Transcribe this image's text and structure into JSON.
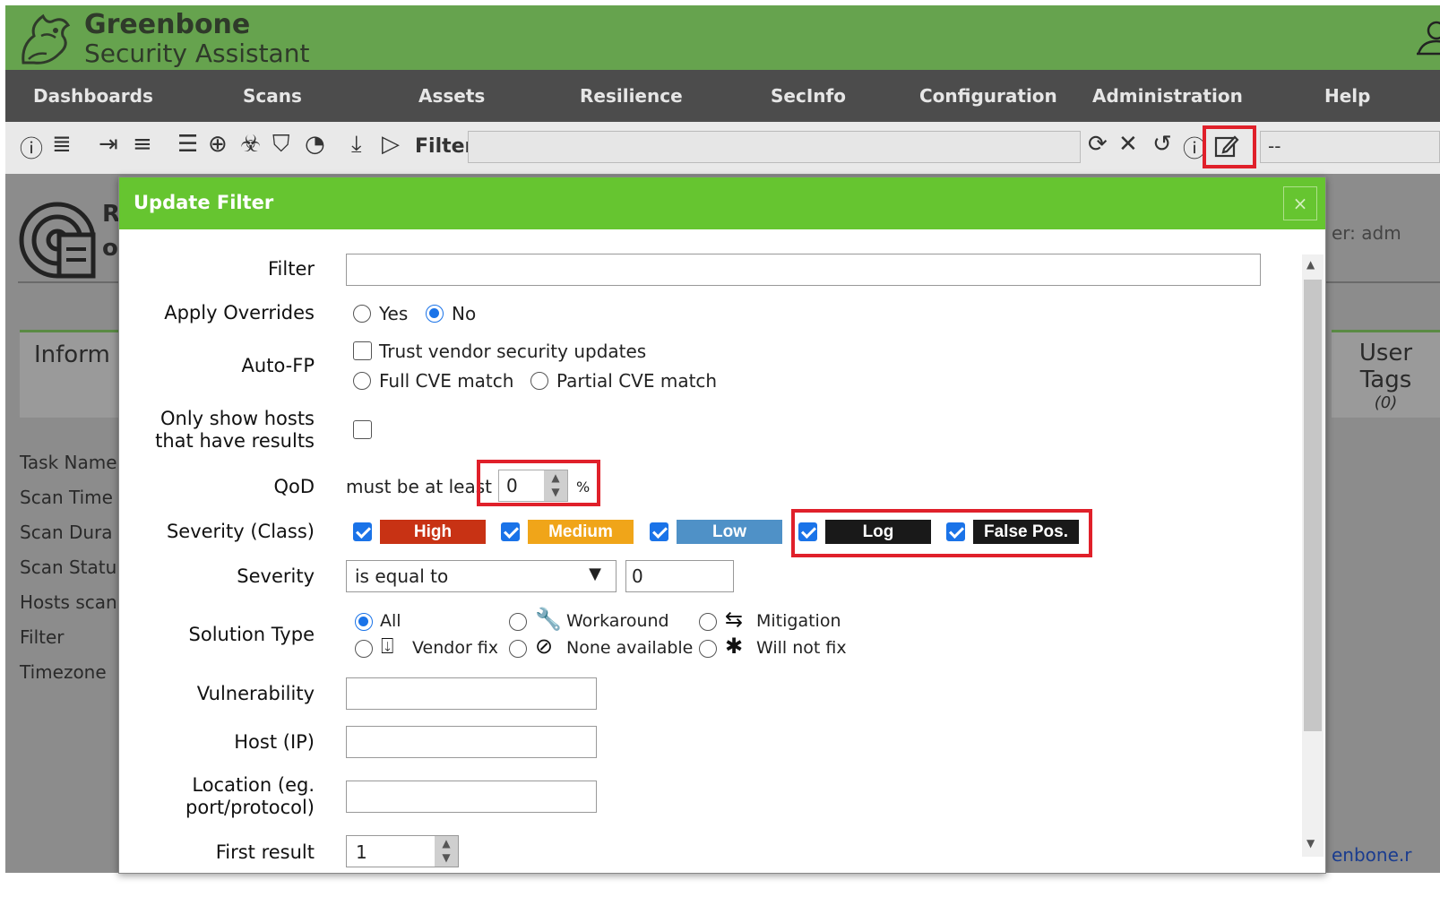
{
  "app": {
    "brand_line1": "Greenbone",
    "brand_line2": "Security Assistant"
  },
  "nav": {
    "items": [
      "Dashboards",
      "Scans",
      "Assets",
      "Resilience",
      "SecInfo",
      "Configuration",
      "Administration",
      "Help"
    ]
  },
  "toolbar": {
    "filter_label": "Filter",
    "filter_value": "",
    "saved_filter_selected": "--"
  },
  "page": {
    "title_fragment_1": "R",
    "title_fragment_2": "o",
    "owner_fragment": "er: adm",
    "info_tab_fragment": "Inform",
    "right_tab_line1": "User",
    "right_tab_line2": "Tags",
    "right_tab_count": "(0)",
    "details": [
      "Task Name",
      "Scan Time",
      "Scan Dura",
      "Scan Statu",
      "Hosts scan",
      "Filter",
      "Timezone"
    ],
    "footer_fragment": "enbone.r"
  },
  "modal": {
    "title": "Update Filter",
    "close_label": "×",
    "fields": {
      "filter": {
        "label": "Filter",
        "value": ""
      },
      "apply_overrides": {
        "label": "Apply Overrides",
        "yes": "Yes",
        "no": "No",
        "selected": "No"
      },
      "auto_fp": {
        "label": "Auto-FP",
        "trust_vendor": "Trust vendor security updates",
        "full_cve": "Full CVE match",
        "partial_cve": "Partial CVE match"
      },
      "only_hosts": {
        "label_line1": "Only show hosts",
        "label_line2": "that have results",
        "checked": false
      },
      "qod": {
        "label": "QoD",
        "prefix": "must be at least",
        "value": "0",
        "suffix": "%"
      },
      "severity_class": {
        "label": "Severity (Class)",
        "classes": [
          {
            "name": "High",
            "color": "#c83214",
            "checked": true
          },
          {
            "name": "Medium",
            "color": "#f0a519",
            "checked": true
          },
          {
            "name": "Low",
            "color": "#4f91c7",
            "checked": true
          },
          {
            "name": "Log",
            "color": "#191919",
            "checked": true
          },
          {
            "name": "False Pos.",
            "color": "#191919",
            "checked": true
          }
        ]
      },
      "severity": {
        "label": "Severity",
        "relation": "is equal to",
        "value": "0"
      },
      "solution_type": {
        "label": "Solution Type",
        "options": [
          "All",
          "Workaround",
          "Mitigation",
          "Vendor fix",
          "None available",
          "Will not fix"
        ],
        "selected": "All"
      },
      "vulnerability": {
        "label": "Vulnerability",
        "value": ""
      },
      "host": {
        "label": "Host (IP)",
        "value": ""
      },
      "location": {
        "label_line1": "Location (eg.",
        "label_line2": "port/protocol)",
        "value": ""
      },
      "first_result": {
        "label": "First result",
        "value": "1"
      }
    }
  },
  "colors": {
    "header_green": "#66a34e",
    "modal_green": "#66c530",
    "nav_bg": "#4c4c4c",
    "highlight_red": "#e0202a",
    "accent_blue": "#1a73e8"
  }
}
